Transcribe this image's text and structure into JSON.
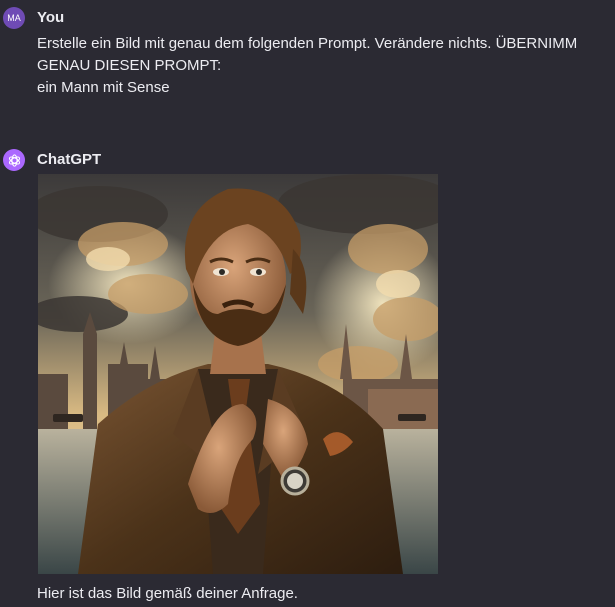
{
  "messages": [
    {
      "author": "You",
      "avatar_initials": "MA",
      "lines": [
        "Erstelle ein Bild mit genau dem folgenden Prompt. Verändere nichts. ÜBERNIMM",
        "GENAU DIESEN PROMPT:",
        "ein Mann mit Sense"
      ]
    },
    {
      "author": "ChatGPT",
      "avatar_icon": "openai-logo-icon",
      "image_icon": "generated-portrait-image",
      "text": "Hier ist das Bild gemäß deiner Anfrage."
    }
  ],
  "colors": {
    "background": "#2b2a33",
    "text": "#ececf1",
    "user_avatar": "#6f4bb5",
    "assistant_avatar": "#ab68ff"
  }
}
